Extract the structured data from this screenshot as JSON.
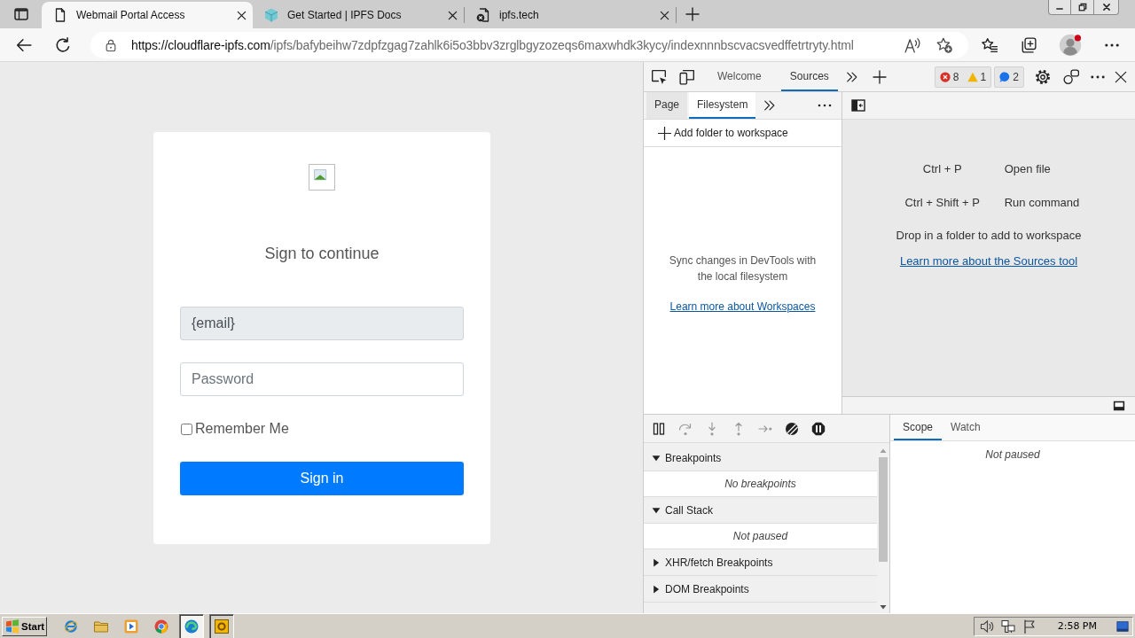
{
  "browser": {
    "tabs": [
      {
        "title": "Webmail Portal Access",
        "kind": "page",
        "selected": true
      },
      {
        "title": "Get Started | IPFS Docs",
        "kind": "cube",
        "selected": false
      },
      {
        "title": "ipfs.tech",
        "kind": "error",
        "selected": false
      }
    ],
    "address_bar": {
      "host": "https://cloudflare-ipfs.com",
      "path": "/ipfs/bafybeihw7zdpfzgag7zahlk6i5o3bbv3zrglbgyzozeqs6maxwhdk3kycy/indexnnnbscvacsvedffetrtryty.html"
    }
  },
  "page": {
    "heading": "Sign to continue",
    "email_field": {
      "value": "{email}"
    },
    "password_field": {
      "placeholder": "Password"
    },
    "remember_me": {
      "label": "Remember Me",
      "checked": false
    },
    "sign_in_button": "Sign in"
  },
  "devtools": {
    "tabs": [
      {
        "label": "Welcome",
        "selected": false
      },
      {
        "label": "Sources",
        "selected": true
      }
    ],
    "issue_buttons": [
      {
        "counts": [
          {
            "kind": "error",
            "count": "8"
          },
          {
            "kind": "warning",
            "count": "1"
          }
        ]
      },
      {
        "counts": [
          {
            "kind": "info",
            "count": "2"
          }
        ]
      }
    ],
    "navigator": {
      "tabs": [
        {
          "label": "Page",
          "selected": false
        },
        {
          "label": "Filesystem",
          "selected": true
        }
      ],
      "add_folder": "Add folder to workspace",
      "message": "Sync changes in DevTools with the local filesystem",
      "link": "Learn more about Workspaces"
    },
    "editor": {
      "shortcuts": [
        {
          "keys": "Ctrl + P",
          "action": "Open file"
        },
        {
          "keys": "Ctrl + Shift + P",
          "action": "Run command"
        }
      ],
      "drop_hint": "Drop in a folder to add to workspace",
      "link": "Learn more about the Sources tool"
    },
    "debugger": {
      "sections": [
        {
          "title": "Breakpoints",
          "expanded": true,
          "message": "No breakpoints"
        },
        {
          "title": "Call Stack",
          "expanded": true,
          "message": "Not paused"
        },
        {
          "title": "XHR/fetch Breakpoints",
          "expanded": false
        },
        {
          "title": "DOM Breakpoints",
          "expanded": false
        }
      ],
      "side_tabs": [
        {
          "label": "Scope",
          "selected": true
        },
        {
          "label": "Watch",
          "selected": false
        }
      ],
      "side_message": "Not paused"
    }
  },
  "taskbar": {
    "start": "Start",
    "apps": [
      {
        "kind": "ie",
        "open": false,
        "selected": false
      },
      {
        "kind": "folder",
        "open": false,
        "selected": false
      },
      {
        "kind": "media",
        "open": false,
        "selected": false
      },
      {
        "kind": "chrome",
        "open": false,
        "selected": false
      },
      {
        "kind": "edge",
        "open": true,
        "selected": true
      },
      {
        "kind": "mail",
        "open": true,
        "selected": false
      }
    ],
    "clock": "2:58 PM"
  }
}
